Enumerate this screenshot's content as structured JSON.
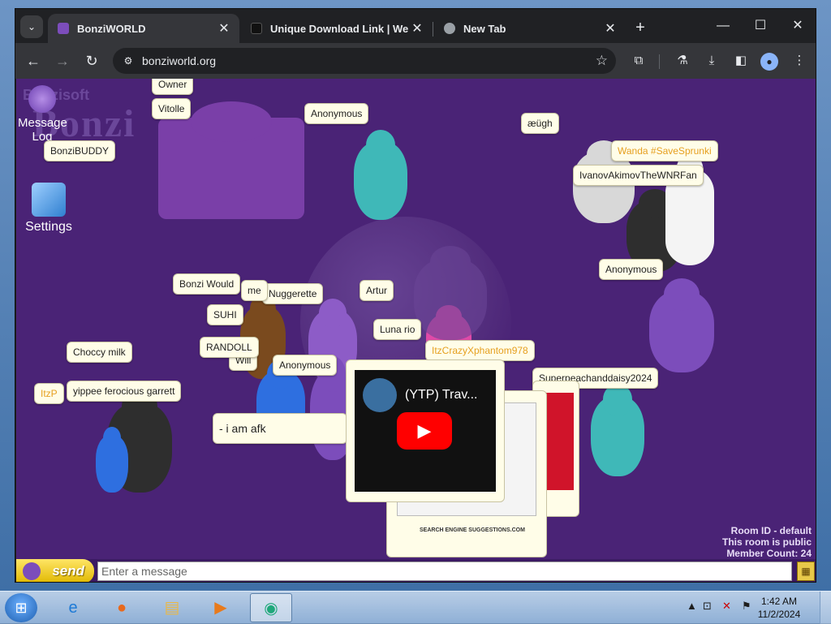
{
  "browser": {
    "tabs": [
      {
        "title": "BonziWORLD",
        "active": true,
        "favicon_color": "#7c4dbb"
      },
      {
        "title": "Unique Download Link | WeTra",
        "active": false,
        "favicon_color": "#111111"
      },
      {
        "title": "New Tab",
        "active": false,
        "favicon_color": "#9aa0a6"
      }
    ],
    "url": "bonziworld.org",
    "new_tab_label": "+",
    "window_controls": {
      "minimize": "—",
      "maximize": "☐",
      "close": "✕"
    }
  },
  "sidebar": {
    "message_log_label": "Message Log",
    "settings_label": "Settings"
  },
  "background": {
    "logo_small": "Bonzisoft",
    "logo_big": "Bonzi"
  },
  "bubbles": [
    {
      "id": "owner",
      "text": "Owner"
    },
    {
      "id": "vitolle",
      "text": "Vitolle"
    },
    {
      "id": "anon1",
      "text": "Anonymous"
    },
    {
      "id": "bonzibuddy",
      "text": "BonziBUDDY"
    },
    {
      "id": "aeugh",
      "text": "æügh"
    },
    {
      "id": "wanda",
      "text": "Wanda #SaveSprunki"
    },
    {
      "id": "ivanov",
      "text": "IvanovAkimovTheWNRFan"
    },
    {
      "id": "anon2",
      "text": "Anonymous"
    },
    {
      "id": "bonzi-would",
      "text": "Bonzi Would"
    },
    {
      "id": "me",
      "text": "me"
    },
    {
      "id": "nuggerette",
      "text": "Nuggerette"
    },
    {
      "id": "artur",
      "text": "Artur"
    },
    {
      "id": "suhi",
      "text": "SUHI"
    },
    {
      "id": "luna",
      "text": "Luna rio"
    },
    {
      "id": "randoll",
      "text": "RANDOLL"
    },
    {
      "id": "will",
      "text": "Will"
    },
    {
      "id": "anon3",
      "text": "Anonymous"
    },
    {
      "id": "itzcrazy",
      "text": "ItzCrazyXphantom978"
    },
    {
      "id": "choccy",
      "text": "Choccy milk"
    },
    {
      "id": "itzp",
      "text": "ItzP"
    },
    {
      "id": "yippee",
      "text": "yippee ferocious garrett"
    },
    {
      "id": "superpeach",
      "text": "Superpeachanddaisy2024"
    },
    {
      "id": "afk",
      "text": "- i am afk"
    }
  ],
  "video": {
    "title": "(YTP) Trav...",
    "play_glyph": "▶"
  },
  "screenshot_caption": "SEARCH ENGINE SUGGESTIONS.COM",
  "room": {
    "id_line": "Room ID - default",
    "public_line": "This room is public",
    "member_line": "Member Count: 24"
  },
  "chat": {
    "send_label": "send",
    "placeholder": "Enter a message"
  },
  "taskbar": {
    "time": "1:42 AM",
    "date": "11/2/2024"
  },
  "colors": {
    "bonzi_purple": "#8d5cc7",
    "bonzi_teal": "#3fb8b8",
    "bonzi_black": "#2e2e2e",
    "bonzi_pink": "#e04aa8",
    "bonzi_white": "#d8d8d8",
    "bonzi_blue": "#2e6fe0",
    "bonzi_brown": "#7a4a1e",
    "bubble_orange_text": "#e6a020"
  }
}
